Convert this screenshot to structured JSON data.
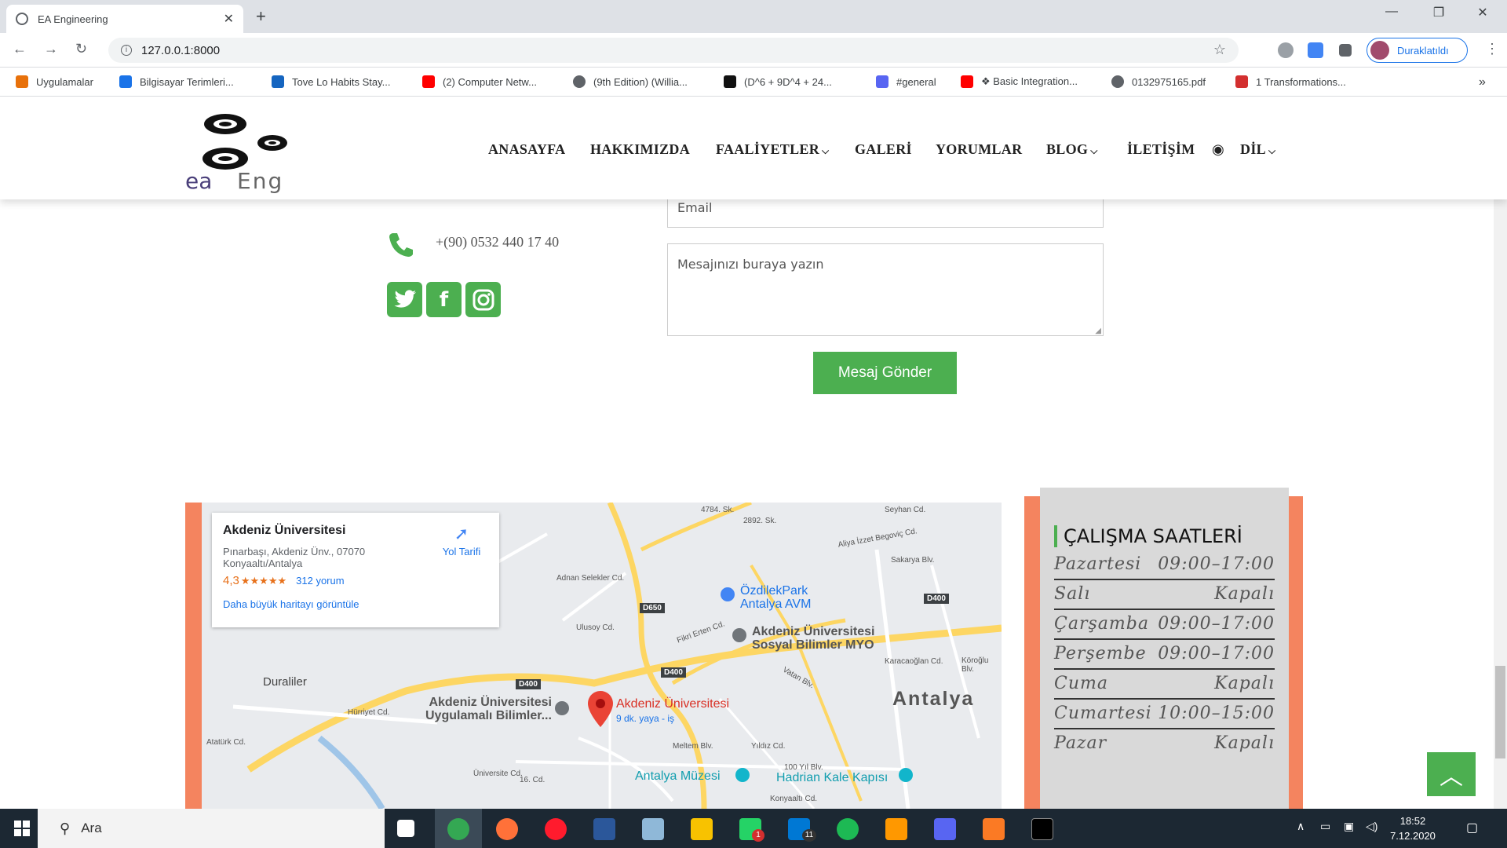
{
  "browser": {
    "tab_title": "EA Engineering",
    "url": "127.0.0.1:8000",
    "profile_label": "Duraklatıldı",
    "bookmarks": [
      {
        "label": "Uygulamalar",
        "icon": "apps-grid-icon"
      },
      {
        "label": "Bilgisayar Terimleri...",
        "icon": "bookmark-icon"
      },
      {
        "label": "Tove Lo Habits Stay...",
        "icon": "shazam-icon"
      },
      {
        "label": "(2) Computer Netw...",
        "icon": "youtube-icon"
      },
      {
        "label": "(9th Edition) (Willia...",
        "icon": "globe-icon"
      },
      {
        "label": "(D^6 + 9D^4 + 24...",
        "icon": "symbolab-icon"
      },
      {
        "label": "#general",
        "icon": "discord-icon"
      },
      {
        "label": "❖ Basic Integration...",
        "icon": "youtube-icon"
      },
      {
        "label": "0132975165.pdf",
        "icon": "globe-icon"
      },
      {
        "label": "1 Transformations...",
        "icon": "oracle-icon"
      }
    ],
    "more_bookmarks": "»"
  },
  "site": {
    "logo_text_a": "ea",
    "logo_text_b": "Eng",
    "nav": [
      {
        "label": "ANASAYFA",
        "dropdown": false
      },
      {
        "label": "HAKKIMIZDA",
        "dropdown": false
      },
      {
        "label": "FAALİYETLER",
        "dropdown": true
      },
      {
        "label": "GALERİ",
        "dropdown": false
      },
      {
        "label": "YORUMLAR",
        "dropdown": false
      },
      {
        "label": "BLOG",
        "dropdown": true
      },
      {
        "label": "İLETİŞİM",
        "dropdown": false
      },
      {
        "label": "DİL",
        "dropdown": true,
        "icon": "globe-icon"
      }
    ]
  },
  "contact": {
    "phone": "+(90) 0532 440 17 40",
    "email_placeholder": "Email",
    "message_placeholder": "Mesajınızı buraya yazın",
    "send_label": "Mesaj Gönder",
    "social": [
      "twitter-icon",
      "facebook-icon",
      "instagram-icon"
    ],
    "accent_color": "#4caf50"
  },
  "map": {
    "place_name": "Akdeniz Üniversitesi",
    "address_line1": "Pınarbaşı, Akdeniz Ünv., 07070",
    "address_line2": "Konyaaltı/Antalya",
    "rating": "4,3",
    "stars": "★★★★★",
    "reviews": "312 yorum",
    "rating_value": 4.3,
    "directions": "Yol Tarifi",
    "larger_map": "Daha büyük haritayı görüntüle",
    "marker_label": "Akdeniz Üniversitesi",
    "marker_sub": "9 dk. yaya - iş",
    "labels": {
      "city": "Antalya",
      "duraliler": "Duraliler",
      "ozdilek1": "ÖzdilekPark",
      "ozdilek2": "Antalya AVM",
      "sosyal1": "Akdeniz Üniversitesi",
      "sosyal2": "Sosyal Bilimler MYO",
      "uygulamali1": "Akdeniz Üniversitesi",
      "uygulamali2": "Uygulamalı Bilimler...",
      "muzesi": "Antalya Müzesi",
      "hadrian": "Hadrian Kale Kapısı",
      "d400a": "D400",
      "d400b": "D400",
      "d400c": "D400",
      "d650": "D650",
      "adnan": "Adnan Selekler Cd.",
      "ulusoy": "Ulusoy Cd.",
      "fikri": "Fikri Erten Cd.",
      "karacaoglan": "Karacaoğlan Cd.",
      "hurriyet": "Hürriyet Cd.",
      "ataturk": "Atatürk Cd.",
      "universite": "Üniversite Cd.",
      "meltem": "Meltem Blv.",
      "yildiz": "Yıldız Cd.",
      "yil100": "100 Yıl Blv.",
      "konyaalti": "Konyaaltı Cd.",
      "seyhan": "Seyhan Cd.",
      "aliya": "Aliya İzzet Begoviç Cd.",
      "sakarya": "Sakarya Blv.",
      "koroglu": "Köroğlu Blv.",
      "vatan": "Vatan Blv.",
      "sk4784": "4784. Sk.",
      "sk2892": "2892. Sk.",
      "cd16": "16. Cd."
    }
  },
  "hours": {
    "title": "ÇALIŞMA SAATLERİ",
    "rows": [
      {
        "day": "Pazartesi",
        "time": "09:00–17:00"
      },
      {
        "day": "Salı",
        "time": "Kapalı"
      },
      {
        "day": "Çarşamba",
        "time": "09:00–17:00"
      },
      {
        "day": "Perşembe",
        "time": "09:00–17:00"
      },
      {
        "day": "Cuma",
        "time": "Kapalı"
      },
      {
        "day": "Cumartesi",
        "time": "10:00–15:00"
      },
      {
        "day": "Pazar",
        "time": "Kapalı"
      }
    ]
  },
  "taskbar": {
    "search_placeholder": "Ara",
    "time": "18:52",
    "date": "7.12.2020",
    "whatsapp_badge": "1",
    "mail_badge": "11"
  }
}
